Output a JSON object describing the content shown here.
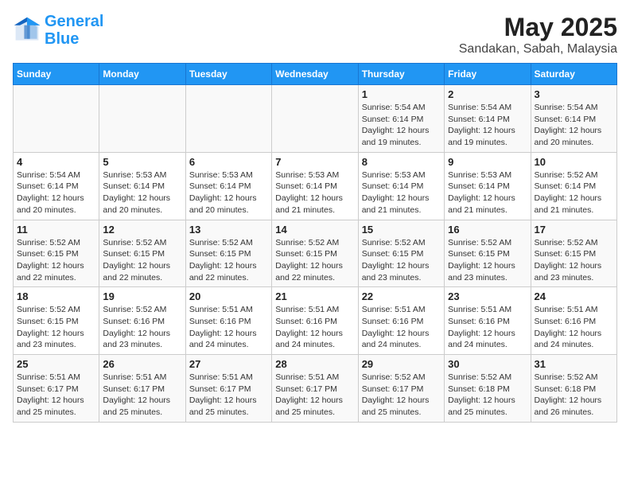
{
  "logo": {
    "line1": "General",
    "line2": "Blue"
  },
  "title": "May 2025",
  "subtitle": "Sandakan, Sabah, Malaysia",
  "headers": [
    "Sunday",
    "Monday",
    "Tuesday",
    "Wednesday",
    "Thursday",
    "Friday",
    "Saturday"
  ],
  "weeks": [
    [
      {
        "day": "",
        "info": ""
      },
      {
        "day": "",
        "info": ""
      },
      {
        "day": "",
        "info": ""
      },
      {
        "day": "",
        "info": ""
      },
      {
        "day": "1",
        "info": "Sunrise: 5:54 AM\nSunset: 6:14 PM\nDaylight: 12 hours\nand 19 minutes."
      },
      {
        "day": "2",
        "info": "Sunrise: 5:54 AM\nSunset: 6:14 PM\nDaylight: 12 hours\nand 19 minutes."
      },
      {
        "day": "3",
        "info": "Sunrise: 5:54 AM\nSunset: 6:14 PM\nDaylight: 12 hours\nand 20 minutes."
      }
    ],
    [
      {
        "day": "4",
        "info": "Sunrise: 5:54 AM\nSunset: 6:14 PM\nDaylight: 12 hours\nand 20 minutes."
      },
      {
        "day": "5",
        "info": "Sunrise: 5:53 AM\nSunset: 6:14 PM\nDaylight: 12 hours\nand 20 minutes."
      },
      {
        "day": "6",
        "info": "Sunrise: 5:53 AM\nSunset: 6:14 PM\nDaylight: 12 hours\nand 20 minutes."
      },
      {
        "day": "7",
        "info": "Sunrise: 5:53 AM\nSunset: 6:14 PM\nDaylight: 12 hours\nand 21 minutes."
      },
      {
        "day": "8",
        "info": "Sunrise: 5:53 AM\nSunset: 6:14 PM\nDaylight: 12 hours\nand 21 minutes."
      },
      {
        "day": "9",
        "info": "Sunrise: 5:53 AM\nSunset: 6:14 PM\nDaylight: 12 hours\nand 21 minutes."
      },
      {
        "day": "10",
        "info": "Sunrise: 5:52 AM\nSunset: 6:14 PM\nDaylight: 12 hours\nand 21 minutes."
      }
    ],
    [
      {
        "day": "11",
        "info": "Sunrise: 5:52 AM\nSunset: 6:15 PM\nDaylight: 12 hours\nand 22 minutes."
      },
      {
        "day": "12",
        "info": "Sunrise: 5:52 AM\nSunset: 6:15 PM\nDaylight: 12 hours\nand 22 minutes."
      },
      {
        "day": "13",
        "info": "Sunrise: 5:52 AM\nSunset: 6:15 PM\nDaylight: 12 hours\nand 22 minutes."
      },
      {
        "day": "14",
        "info": "Sunrise: 5:52 AM\nSunset: 6:15 PM\nDaylight: 12 hours\nand 22 minutes."
      },
      {
        "day": "15",
        "info": "Sunrise: 5:52 AM\nSunset: 6:15 PM\nDaylight: 12 hours\nand 23 minutes."
      },
      {
        "day": "16",
        "info": "Sunrise: 5:52 AM\nSunset: 6:15 PM\nDaylight: 12 hours\nand 23 minutes."
      },
      {
        "day": "17",
        "info": "Sunrise: 5:52 AM\nSunset: 6:15 PM\nDaylight: 12 hours\nand 23 minutes."
      }
    ],
    [
      {
        "day": "18",
        "info": "Sunrise: 5:52 AM\nSunset: 6:15 PM\nDaylight: 12 hours\nand 23 minutes."
      },
      {
        "day": "19",
        "info": "Sunrise: 5:52 AM\nSunset: 6:16 PM\nDaylight: 12 hours\nand 23 minutes."
      },
      {
        "day": "20",
        "info": "Sunrise: 5:51 AM\nSunset: 6:16 PM\nDaylight: 12 hours\nand 24 minutes."
      },
      {
        "day": "21",
        "info": "Sunrise: 5:51 AM\nSunset: 6:16 PM\nDaylight: 12 hours\nand 24 minutes."
      },
      {
        "day": "22",
        "info": "Sunrise: 5:51 AM\nSunset: 6:16 PM\nDaylight: 12 hours\nand 24 minutes."
      },
      {
        "day": "23",
        "info": "Sunrise: 5:51 AM\nSunset: 6:16 PM\nDaylight: 12 hours\nand 24 minutes."
      },
      {
        "day": "24",
        "info": "Sunrise: 5:51 AM\nSunset: 6:16 PM\nDaylight: 12 hours\nand 24 minutes."
      }
    ],
    [
      {
        "day": "25",
        "info": "Sunrise: 5:51 AM\nSunset: 6:17 PM\nDaylight: 12 hours\nand 25 minutes."
      },
      {
        "day": "26",
        "info": "Sunrise: 5:51 AM\nSunset: 6:17 PM\nDaylight: 12 hours\nand 25 minutes."
      },
      {
        "day": "27",
        "info": "Sunrise: 5:51 AM\nSunset: 6:17 PM\nDaylight: 12 hours\nand 25 minutes."
      },
      {
        "day": "28",
        "info": "Sunrise: 5:51 AM\nSunset: 6:17 PM\nDaylight: 12 hours\nand 25 minutes."
      },
      {
        "day": "29",
        "info": "Sunrise: 5:52 AM\nSunset: 6:17 PM\nDaylight: 12 hours\nand 25 minutes."
      },
      {
        "day": "30",
        "info": "Sunrise: 5:52 AM\nSunset: 6:18 PM\nDaylight: 12 hours\nand 25 minutes."
      },
      {
        "day": "31",
        "info": "Sunrise: 5:52 AM\nSunset: 6:18 PM\nDaylight: 12 hours\nand 26 minutes."
      }
    ]
  ]
}
